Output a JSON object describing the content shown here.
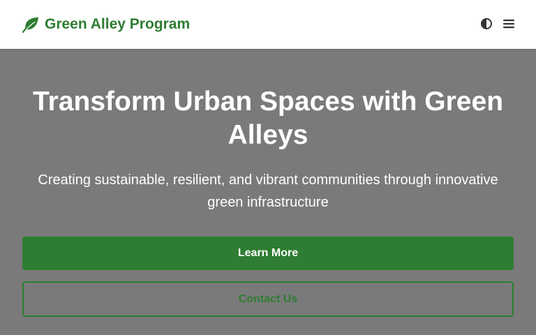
{
  "header": {
    "brand_name": "Green Alley Program",
    "brand_icon": "leaf-icon",
    "theme_toggle_icon": "half-moon-icon",
    "menu_icon": "hamburger-menu-icon"
  },
  "hero": {
    "title": "Transform Urban Spaces with Green Alleys",
    "subtitle": "Creating sustainable, resilient, and vibrant communities through innovative green infrastructure",
    "primary_button": "Learn More",
    "secondary_button": "Contact Us"
  },
  "colors": {
    "brand_green": "#2e7d32",
    "hero_background": "#7a7a7a",
    "header_background": "#ffffff",
    "icon_dark": "#333333"
  }
}
